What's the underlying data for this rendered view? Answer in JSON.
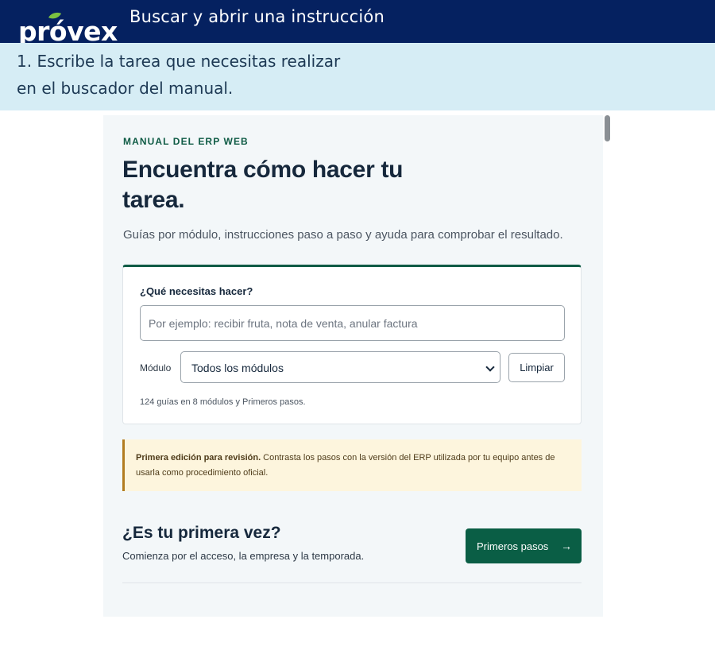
{
  "header": {
    "brand": "próvex",
    "title": "Buscar y abrir una instrucción"
  },
  "instruction": {
    "text": "1. Escribe la tarea que necesitas realizar en el buscador del manual."
  },
  "manual": {
    "eyebrow": "MANUAL DEL ERP WEB",
    "title": "Encuentra cómo hacer tu tarea.",
    "subtitle": "Guías por módulo, instrucciones paso a paso y ayuda para comprobar el resultado.",
    "search": {
      "label": "¿Qué necesitas hacer?",
      "value": "",
      "placeholder": "Por ejemplo: recibir fruta, nota de venta, anular factura",
      "module_label": "Módulo",
      "module_selected": "Todos los módulos",
      "clear_label": "Limpiar",
      "results": "124 guías en 8 módulos y Primeros pasos."
    },
    "notice": {
      "strong": "Primera edición para revisión.",
      "text": " Contrasta los pasos con la versión del ERP utilizada por tu equipo antes de usarla como procedimiento oficial."
    },
    "first_time": {
      "title": "¿Es tu primera vez?",
      "subtitle": "Comienza por el acceso, la empresa y la temporada.",
      "button_label": "Primeros pasos",
      "button_arrow": "→"
    }
  },
  "colors": {
    "header_bg": "#052160",
    "instruction_bg": "#d6edf5",
    "brand_green": "#0f5b45",
    "logo_leaf": "#7cc241",
    "notice_bg": "#fdf5dd",
    "notice_border": "#b27c1f"
  },
  "icons": {
    "logo": "provex-logo-leaf",
    "select": "chevron-down-icon",
    "button": "arrow-right-icon"
  }
}
